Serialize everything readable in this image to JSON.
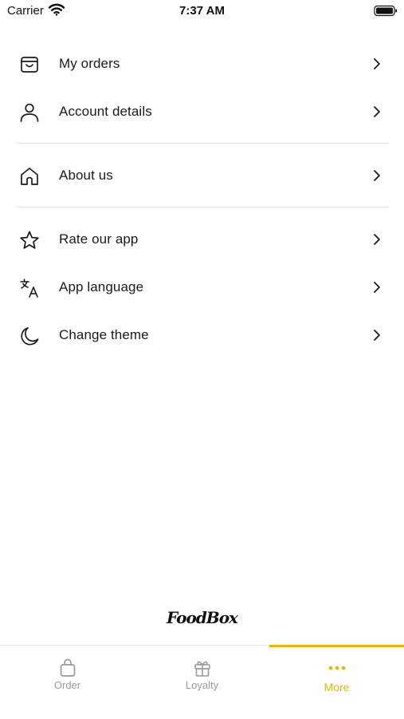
{
  "status_bar": {
    "carrier": "Carrier",
    "time": "7:37 AM"
  },
  "menu": {
    "items": [
      {
        "label": "My orders",
        "icon": "shopping-bag-icon"
      },
      {
        "label": "Account details",
        "icon": "person-icon"
      },
      {
        "label": "About us",
        "icon": "home-icon"
      },
      {
        "label": "Rate our app",
        "icon": "star-icon"
      },
      {
        "label": "App language",
        "icon": "translate-icon"
      },
      {
        "label": "Change theme",
        "icon": "moon-icon"
      }
    ]
  },
  "logo": {
    "text": "FoodBox"
  },
  "tab_bar": {
    "tabs": [
      {
        "label": "Order",
        "icon": "bag-icon"
      },
      {
        "label": "Loyalty",
        "icon": "gift-icon"
      },
      {
        "label": "More",
        "icon": "more-dots-icon",
        "active": true
      }
    ],
    "accent_color": "#f0b400",
    "inactive_color": "#9a9a9a"
  }
}
